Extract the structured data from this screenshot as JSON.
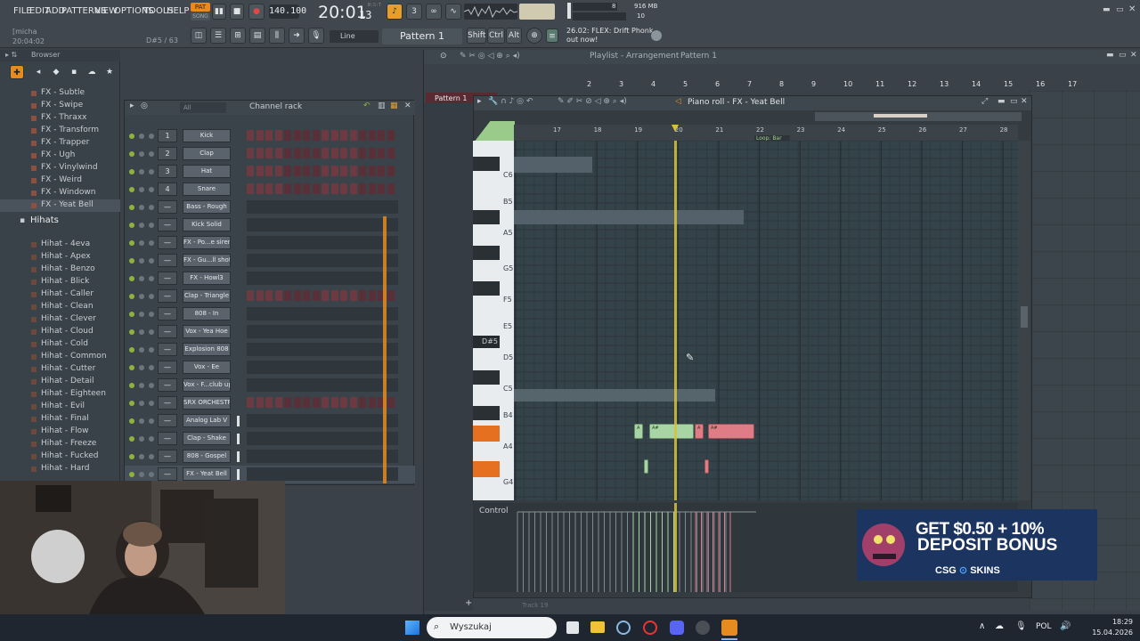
{
  "menu": [
    "FILE",
    "EDIT",
    "ADD",
    "PATTERNS",
    "VIEW",
    "OPTIONS",
    "TOOLS",
    "HELP"
  ],
  "transport": {
    "pat_label": "PAT",
    "song_label": "SONG",
    "tempo": "140.100",
    "time_main": "20:01",
    "time_sub": "13",
    "time_label": "B:S:T",
    "cpu": "8",
    "mem": "916 MB",
    "poly": "10"
  },
  "hint": {
    "user": "[micha",
    "time": "20:04:02",
    "key": "D#5 / 63"
  },
  "toolbar": {
    "snap": "Line",
    "pattern": "Pattern 1",
    "shift": "Shift",
    "ctrl": "Ctrl",
    "alt": "Alt"
  },
  "news": {
    "line1": "26.02: FLEX: Drift Phonk",
    "line2": "out now!"
  },
  "browser": {
    "title": "Browser",
    "items": [
      "FX - Subtle",
      "FX - Swipe",
      "FX - Thraxx",
      "FX - Transform",
      "FX - Trapper",
      "FX - Ugh",
      "FX - Vinylwind",
      "FX - Weird",
      "FX - Windown",
      "FX - Yeat Bell"
    ],
    "folder": "Hihats",
    "hihats": [
      "Hihat - 4eva",
      "Hihat - Apex",
      "Hihat - Benzo",
      "Hihat - Blick",
      "Hihat - Caller",
      "Hihat - Clean",
      "Hihat - Clever",
      "Hihat - Cloud",
      "Hihat - Cold",
      "Hihat - Common",
      "Hihat - Cutter",
      "Hihat - Detail",
      "Hihat - Eighteen",
      "Hihat - Evil",
      "Hihat - Final",
      "Hihat - Flow",
      "Hihat - Freeze",
      "Hihat - Fucked",
      "Hihat - Hard"
    ]
  },
  "channel_rack": {
    "title": "Channel rack",
    "filter": "All",
    "channels": [
      {
        "num": "1",
        "name": "Kick"
      },
      {
        "num": "2",
        "name": "Clap"
      },
      {
        "num": "3",
        "name": "Hat"
      },
      {
        "num": "4",
        "name": "Snare"
      },
      {
        "num": "—",
        "name": "Bass - Rough"
      },
      {
        "num": "—",
        "name": "Kick Solid"
      },
      {
        "num": "—",
        "name": "FX - Po...e siren"
      },
      {
        "num": "—",
        "name": "FX - Gu...ll shot"
      },
      {
        "num": "—",
        "name": "FX - Howl3"
      },
      {
        "num": "—",
        "name": "Clap - Triangle"
      },
      {
        "num": "—",
        "name": "808 - In"
      },
      {
        "num": "—",
        "name": "Vox - Yea Hoe"
      },
      {
        "num": "—",
        "name": "Explosion 808"
      },
      {
        "num": "—",
        "name": "Vox - Ee"
      },
      {
        "num": "—",
        "name": "Vox - F...club up"
      },
      {
        "num": "—",
        "name": "SRX ORCHESTRA"
      },
      {
        "num": "—",
        "name": "Analog Lab V"
      },
      {
        "num": "—",
        "name": "Clap - Shake"
      },
      {
        "num": "—",
        "name": "808 - Gospel"
      },
      {
        "num": "—",
        "name": "FX - Yeat Bell"
      }
    ]
  },
  "playlist": {
    "title": "Playlist - Arrangement",
    "pattern": "Pattern 1",
    "bars": [
      "2",
      "3",
      "4",
      "5",
      "6",
      "7",
      "8",
      "9",
      "10",
      "11",
      "12",
      "13",
      "14",
      "15",
      "16",
      "17"
    ],
    "track_label": "Pattern 1",
    "bottom_track": "Track 19"
  },
  "piano_roll": {
    "title": "Piano roll - FX - Yeat Bell",
    "bars": [
      "17",
      "18",
      "19",
      "20",
      "21",
      "22",
      "23",
      "24",
      "25",
      "26",
      "27",
      "28"
    ],
    "loop": "Loop: Bar",
    "keys": [
      "C6",
      "B5",
      "A5",
      "G5",
      "F5",
      "E5",
      "D#5",
      "D5",
      "C5",
      "B4",
      "A4",
      "G4"
    ],
    "note_labels": [
      "A",
      "A#",
      "A",
      "A#"
    ],
    "control": "Control",
    "colors": {
      "green": "#a7d6a4",
      "red": "#e07c85",
      "playhead": "#d8c23a"
    }
  },
  "taskbar": {
    "search": "Wyszukaj",
    "lang": "POL",
    "time": "18:29",
    "date": "15.04.2026"
  },
  "ad": {
    "line1": "GET $0.50 + 10%",
    "line2": "DEPOSIT BONUS",
    "brand": "CSG",
    "brand2": "SKINS"
  }
}
